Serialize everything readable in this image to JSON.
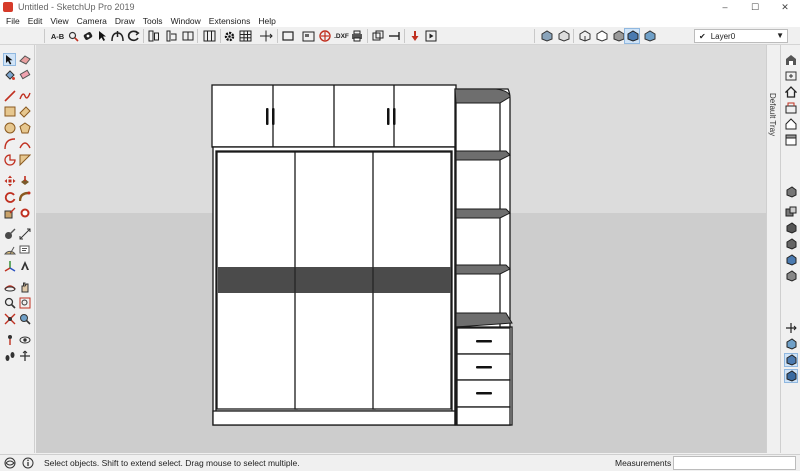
{
  "window": {
    "title": "Untitled - SketchUp Pro 2019",
    "controls": {
      "minimize": "–",
      "maximize": "☐",
      "close": "✕"
    }
  },
  "menu": [
    "File",
    "Edit",
    "View",
    "Camera",
    "Draw",
    "Tools",
    "Window",
    "Extensions",
    "Help"
  ],
  "toolbar": {
    "dimension_label": "A-B",
    "dxf_label": ".DXF",
    "layer_value": "Layer0",
    "layer_check": "✔"
  },
  "tray": {
    "label": "Default Tray"
  },
  "status": {
    "message": "Select objects. Shift to extend select. Drag mouse to select multiple.",
    "measurements_label": "Measurements",
    "measurements_value": ""
  },
  "colors": {
    "sky": "#dcdcdc",
    "ground": "#cdcdcd",
    "edge": "#1a1a1a",
    "face": "#ffffff",
    "shelf": "#6e6e6e",
    "band": "#4b4b4b"
  }
}
